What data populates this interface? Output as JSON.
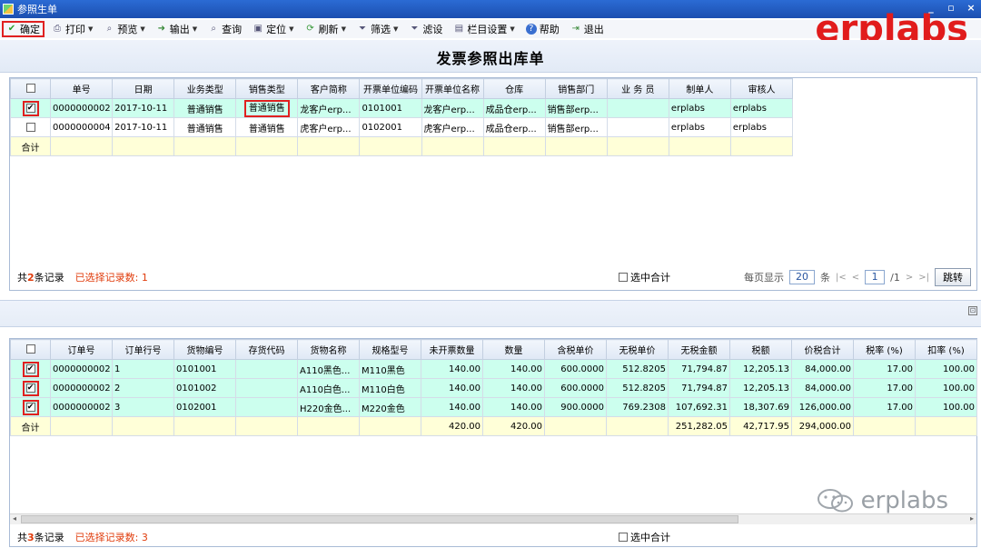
{
  "window": {
    "title": "参照生单",
    "controls": [
      "_",
      "▫",
      "×"
    ]
  },
  "toolbar": {
    "confirm": "确定",
    "print": "打印",
    "preview": "预览",
    "export": "输出",
    "query": "查询",
    "locate": "定位",
    "refresh": "刷新",
    "filter": "筛选",
    "subfilter": "滤设",
    "columns": "栏目设置",
    "help": "帮助",
    "exit": "退出"
  },
  "brand": "erplabs",
  "page_title": "发票参照出库单",
  "top_grid": {
    "headers": [
      "单号",
      "日期",
      "业务类型",
      "销售类型",
      "客户简称",
      "开票单位编码",
      "开票单位名称",
      "仓库",
      "销售部门",
      "业 务 员",
      "制单人",
      "审核人"
    ],
    "rows": [
      {
        "checked": true,
        "cells": [
          "0000000002",
          "2017-10-11",
          "普通销售",
          "普通销售",
          "龙客户erp...",
          "0101001",
          "龙客户erp...",
          "成品仓erp...",
          "销售部erp...",
          "",
          "erplabs",
          "erplabs"
        ]
      },
      {
        "checked": false,
        "cells": [
          "0000000004",
          "2017-10-11",
          "普通销售",
          "普通销售",
          "虎客户erp...",
          "0102001",
          "虎客户erp...",
          "成品仓erp...",
          "销售部erp...",
          "",
          "erplabs",
          "erplabs"
        ]
      }
    ],
    "total_label": "合计"
  },
  "top_status": {
    "count_prefix": "共",
    "count": "2",
    "count_suffix": "条记录",
    "selected": "已选择记录数: 1",
    "sum_selected": "选中合计",
    "page_size_label": "每页显示",
    "page_size": "20",
    "page_size_unit": "条",
    "page_current": "1",
    "page_total": "/1",
    "go": "跳转"
  },
  "bottom_grid": {
    "headers": [
      "订单号",
      "订单行号",
      "货物编号",
      "存货代码",
      "货物名称",
      "规格型号",
      "未开票数量",
      "数量",
      "含税单价",
      "无税单价",
      "无税金额",
      "税额",
      "价税合计",
      "税率 (%)",
      "扣率 (%)"
    ],
    "rows": [
      {
        "checked": true,
        "cells": [
          "0000000002",
          "1",
          "0101001",
          "",
          "A110黑色...",
          "M110黑色",
          "140.00",
          "140.00",
          "600.0000",
          "512.8205",
          "71,794.87",
          "12,205.13",
          "84,000.00",
          "17.00",
          "100.00"
        ]
      },
      {
        "checked": true,
        "cells": [
          "0000000002",
          "2",
          "0101002",
          "",
          "A110白色...",
          "M110白色",
          "140.00",
          "140.00",
          "600.0000",
          "512.8205",
          "71,794.87",
          "12,205.13",
          "84,000.00",
          "17.00",
          "100.00"
        ]
      },
      {
        "checked": true,
        "cells": [
          "0000000002",
          "3",
          "0102001",
          "",
          "H220金色...",
          "M220金色",
          "140.00",
          "140.00",
          "900.0000",
          "769.2308",
          "107,692.31",
          "18,307.69",
          "126,000.00",
          "17.00",
          "100.00"
        ]
      }
    ],
    "total_label": "合计",
    "totals": [
      "",
      "",
      "",
      "",
      "",
      "",
      "420.00",
      "420.00",
      "",
      "",
      "251,282.05",
      "42,717.95",
      "294,000.00",
      "",
      ""
    ]
  },
  "bottom_status": {
    "count_prefix": "共",
    "count": "3",
    "count_suffix": "条记录",
    "selected": "已选择记录数: 3",
    "sum_selected": "选中合计"
  },
  "watermark": "erplabs"
}
